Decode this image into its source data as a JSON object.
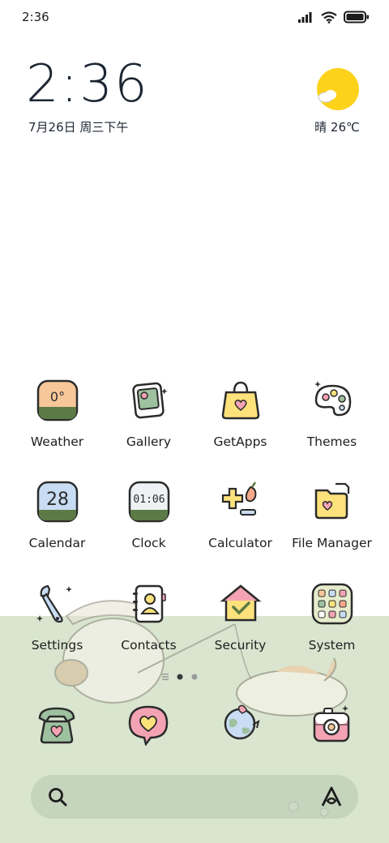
{
  "status_bar": {
    "time": "2:36",
    "icons": [
      "signal-icon",
      "wifi-icon",
      "battery-icon"
    ]
  },
  "clock_widget": {
    "time": "2:36",
    "date": "7月26日 周三下午"
  },
  "weather_widget": {
    "text": "晴 26℃",
    "icon": "sun-cloud-icon"
  },
  "apps": {
    "weather": {
      "label": "Weather",
      "icon_text": "0°"
    },
    "gallery": {
      "label": "Gallery"
    },
    "getapps": {
      "label": "GetApps"
    },
    "themes": {
      "label": "Themes"
    },
    "calendar": {
      "label": "Calendar",
      "icon_text": "28"
    },
    "clock": {
      "label": "Clock",
      "icon_text": "01:06"
    },
    "calculator": {
      "label": "Calculator"
    },
    "file_manager": {
      "label": "File Manager"
    },
    "settings": {
      "label": "Settings"
    },
    "contacts": {
      "label": "Contacts"
    },
    "security": {
      "label": "Security"
    },
    "system": {
      "label": "System"
    }
  },
  "dock": [
    "phone-icon",
    "messages-icon",
    "browser-icon",
    "camera-icon"
  ],
  "page_indicator": {
    "pages": 3,
    "current": 2
  },
  "search_bar": {
    "icons": [
      "search-icon",
      "assistant-icon"
    ]
  },
  "colors": {
    "accent_yellow": "#fde27c",
    "accent_orange": "#f7c79a",
    "accent_pink": "#f4a3b4",
    "accent_green": "#5c7a45",
    "accent_blue": "#c8ddf3",
    "hill_green": "#d9e5cf"
  }
}
